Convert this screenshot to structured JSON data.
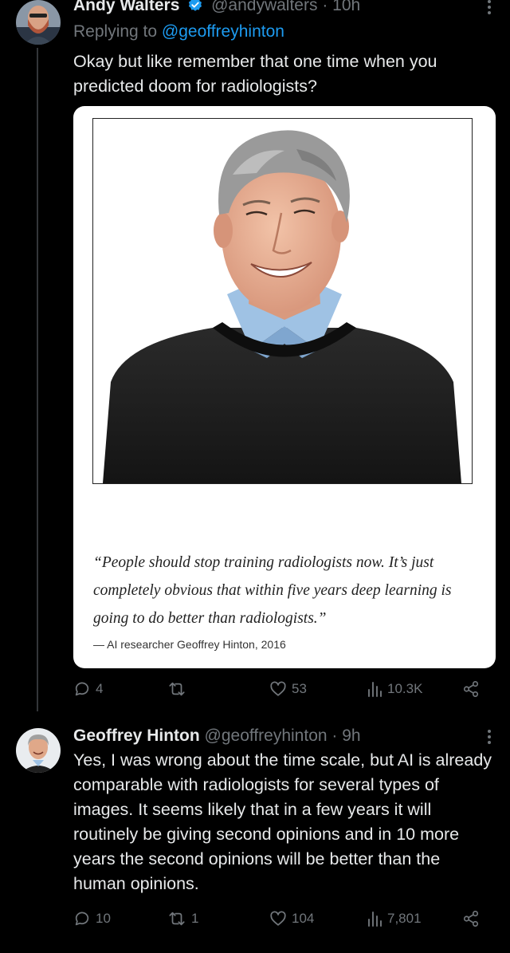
{
  "tweet1": {
    "author_name": "Andy Walters",
    "handle_time": "@andywalters · 10h",
    "replying_prefix": "Replying to ",
    "replying_to": "@geoffreyhinton",
    "text": "Okay but like remember that one time when you predicted doom for radiologists?",
    "card": {
      "quote": "“People should stop training radiologists now. It’s just completely obvious that within five years deep learning is going to do better than radiologists.”",
      "attribution": "— AI researcher Geoffrey Hinton, 2016"
    },
    "actions": {
      "replies": "4",
      "retweets": "",
      "likes": "53",
      "views": "10.3K"
    }
  },
  "tweet2": {
    "author_name": "Geoffrey Hinton",
    "handle_time": "@geoffreyhinton · 9h",
    "text": "Yes, I was wrong about the time scale, but AI is already comparable with radiologists for several types of images. It seems likely that in a few years it will routinely be giving second opinions and in 10 more years the second opinions will be better than the human opinions.",
    "actions": {
      "replies": "10",
      "retweets": "1",
      "likes": "104",
      "views": "7,801"
    }
  },
  "colors": {
    "background": "#000000",
    "text": "#e7e9ea",
    "secondary": "#71767b",
    "link": "#1d9bf0",
    "verified": "#1d9bf0"
  },
  "icons": [
    "verified-badge-icon",
    "more-icon",
    "reply-icon",
    "retweet-icon",
    "like-icon",
    "views-icon",
    "share-icon"
  ]
}
